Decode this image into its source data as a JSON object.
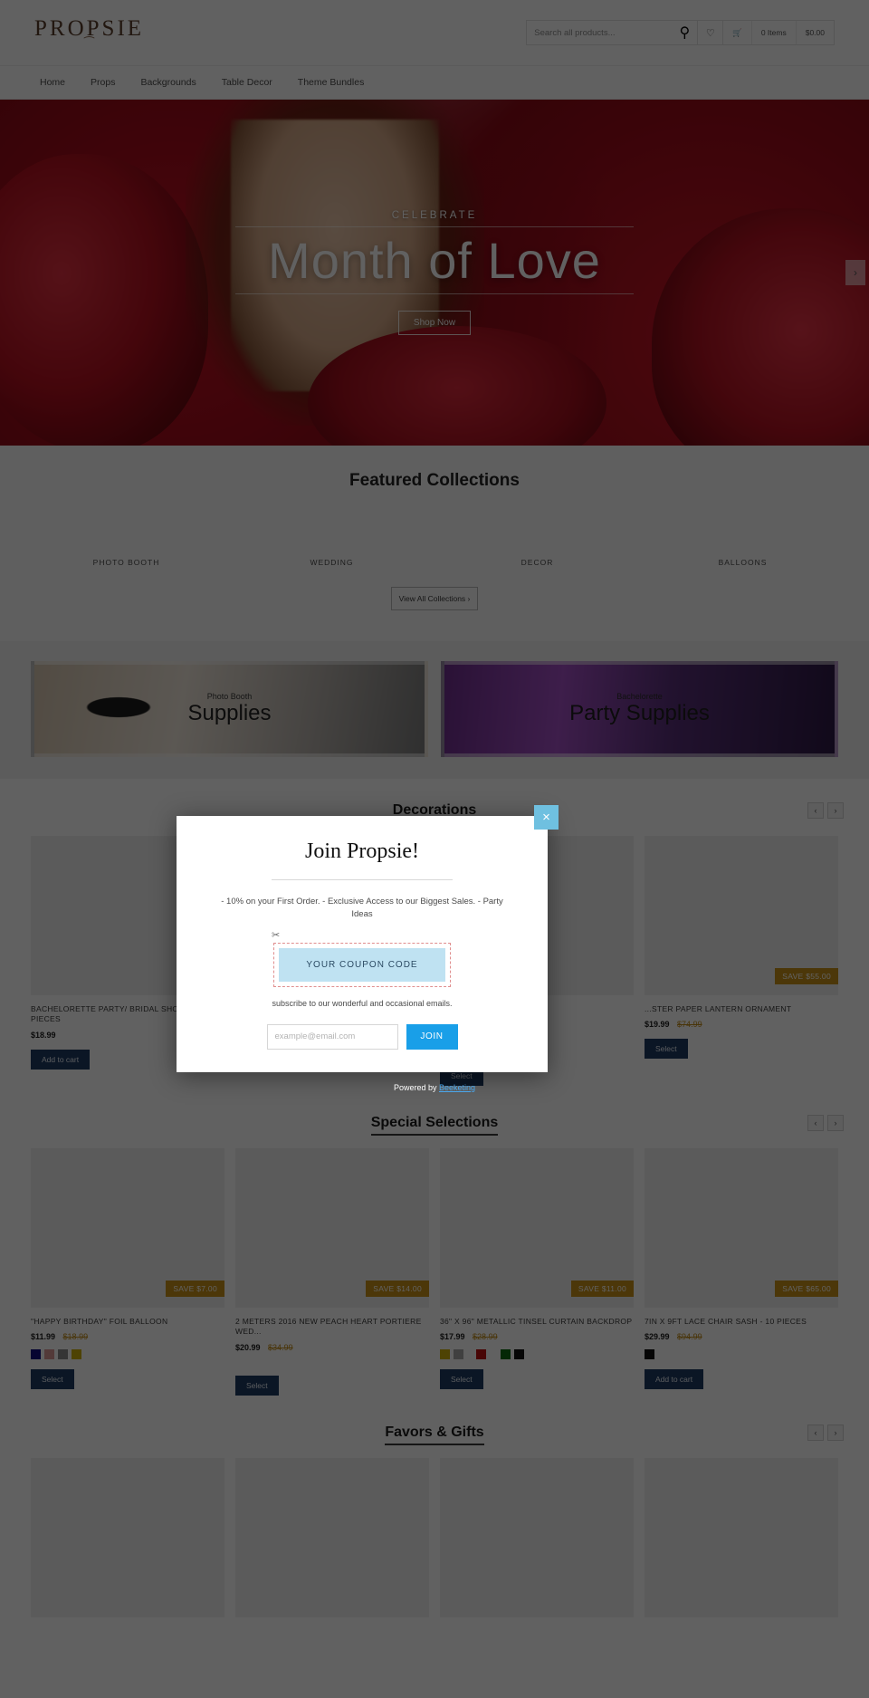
{
  "header": {
    "logo": "PROPSIE",
    "logo_swirl": "⁀",
    "search": {
      "placeholder": "Search all products...",
      "value": "",
      "icon": "search-icon"
    },
    "wishlist_icon": "heart-icon",
    "cart_icon": "cart-icon",
    "cart_items": "0 Items",
    "cart_total": "$0.00"
  },
  "nav": {
    "items": [
      "Home",
      "Props",
      "Backgrounds",
      "Table Decor",
      "Theme Bundles"
    ]
  },
  "hero": {
    "eyebrow": "CELEBRATE",
    "title": "Month of Love",
    "cta": "Shop Now",
    "next_arrow": "›"
  },
  "featured": {
    "title": "Featured Collections",
    "collections": [
      "PHOTO BOOTH",
      "WEDDING",
      "DECOR",
      "BALLOONS"
    ],
    "view_all": "View All Collections ›"
  },
  "promos": [
    {
      "sub": "Photo Booth",
      "title": "Supplies"
    },
    {
      "sub": "Bachelorette",
      "title": "Party Supplies"
    }
  ],
  "sections": [
    {
      "title": "Decorations",
      "prev": "‹",
      "next": "›",
      "products": [
        {
          "img": "im-bachelorette",
          "name": "BACHELORETTE PARTY/ BRIDAL SHOWER- 22 PIECES",
          "price": "$18.99",
          "was": "",
          "badge": "",
          "swatches": [],
          "button": "Add to cart"
        },
        {
          "img": "im-flowers",
          "name": "",
          "price": "",
          "was": "",
          "badge": "",
          "swatches": [],
          "button": ""
        },
        {
          "img": "im-hearts",
          "name": "",
          "price": "",
          "was": "",
          "badge": "",
          "swatches": [],
          "button": "Select"
        },
        {
          "img": "im-lantern",
          "name": "...STER PAPER LANTERN ORNAMENT",
          "price": "$19.99",
          "was": "$74.99",
          "badge": "SAVE $55.00",
          "swatches": [],
          "button": "Select"
        }
      ]
    },
    {
      "title": "Special Selections",
      "prev": "‹",
      "next": "›",
      "products": [
        {
          "img": "im-hbd",
          "name": "\"HAPPY BIRTHDAY\" FOIL BALLOON",
          "price": "$11.99",
          "was": "$18.99",
          "badge": "SAVE $7.00",
          "swatches": [
            "#120b82",
            "#d99a96",
            "#8c8c8c",
            "#cdb00c"
          ],
          "button": "Select"
        },
        {
          "img": "im-portiere",
          "name": "2 METERS 2016 NEW PEACH HEART PORTIERE WED...",
          "price": "$20.99",
          "was": "$34.99",
          "badge": "SAVE $14.00",
          "swatches": [],
          "button": "Select"
        },
        {
          "img": "im-tinsel",
          "name": "36\" X 96\" METALLIC TINSEL CURTAIN BACKDROP",
          "price": "$17.99",
          "was": "$28.99",
          "badge": "SAVE $11.00",
          "swatches": [
            "#cdb00c",
            "#a8a8a8",
            "#bd1212",
            "#0c6b10",
            "#111111"
          ],
          "button": "Select"
        },
        {
          "img": "im-sash",
          "name": "7IN X 9FT LACE CHAIR SASH - 10 PIECES",
          "price": "$29.99",
          "was": "$94.99",
          "badge": "SAVE $65.00",
          "swatches": [
            "#111111"
          ],
          "button": "Add to cart"
        }
      ]
    },
    {
      "title": "Favors & Gifts",
      "prev": "‹",
      "next": "›",
      "products": [
        {
          "img": "im-gift1",
          "name": "",
          "price": "",
          "was": "",
          "badge": "",
          "swatches": [],
          "button": ""
        },
        {
          "img": "im-gift2",
          "name": "",
          "price": "",
          "was": "",
          "badge": "",
          "swatches": [],
          "button": ""
        },
        {
          "img": "im-gift3",
          "name": "",
          "price": "",
          "was": "",
          "badge": "",
          "swatches": [],
          "button": ""
        },
        {
          "img": "im-gift4",
          "name": "",
          "price": "",
          "was": "",
          "badge": "",
          "swatches": [],
          "button": ""
        }
      ]
    }
  ],
  "modal": {
    "title": "Join Propsie!",
    "description": "- 10% on your First Order. - Exclusive Access to our Biggest Sales. - Party Ideas",
    "coupon_code": "YOUR COUPON CODE",
    "subtext": "subscribe to our wonderful and occasional emails.",
    "email_placeholder": "example@email.com",
    "email_value": "",
    "join_label": "JOIN",
    "close_icon": "×",
    "scissors_icon": "✂",
    "powered_prefix": "Powered by ",
    "powered_link": "Beeketing"
  },
  "colors": {
    "accent_blue": "#199fe8",
    "coupon_bg": "#bfe2f2",
    "badge_gold": "#c79218",
    "button_navy": "#1f3b63",
    "close_teal": "#6fc0e0"
  }
}
